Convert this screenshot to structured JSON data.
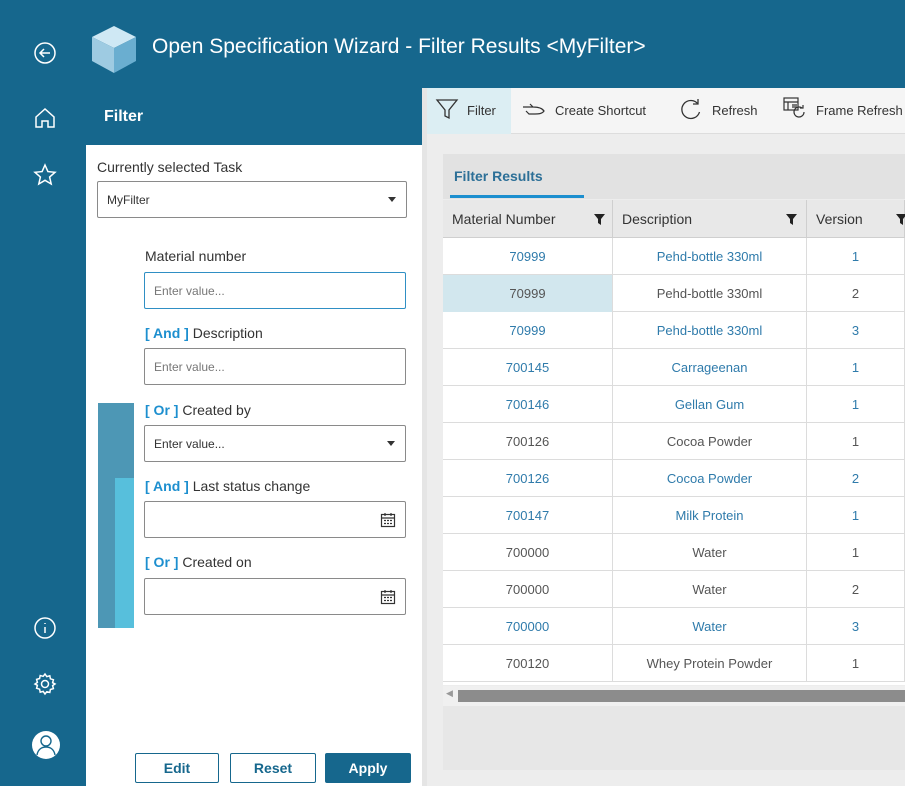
{
  "app": {
    "title": "Open Specification Wizard - Filter Results <MyFilter>",
    "accent": "#16678d",
    "highlight": "#1d8fcf"
  },
  "rail": {
    "items": [
      {
        "icon": "back-arrow-icon"
      },
      {
        "icon": "home-icon"
      },
      {
        "icon": "star-icon"
      },
      {
        "icon": "info-icon"
      },
      {
        "icon": "gear-icon"
      },
      {
        "icon": "user-avatar-icon"
      }
    ]
  },
  "filter": {
    "header": "Filter",
    "task_label": "Currently selected Task",
    "task_value": "MyFilter",
    "fields": [
      {
        "operator": "",
        "label": "Material number",
        "placeholder": "Enter value..."
      },
      {
        "operator": "[ And ]",
        "label": " Description",
        "placeholder": "Enter value..."
      },
      {
        "operator": "[ Or ]",
        "label": " Created by",
        "placeholder": "Enter value..."
      },
      {
        "operator": "[ And ]",
        "label": " Last status change",
        "placeholder": ""
      },
      {
        "operator": "[ Or ]",
        "label": " Created on",
        "placeholder": ""
      }
    ],
    "buttons": {
      "edit": "Edit",
      "reset": "Reset",
      "apply": "Apply"
    }
  },
  "toolbar": {
    "filter": "Filter",
    "create_shortcut": "Create Shortcut",
    "refresh": "Refresh",
    "frame_refresh": "Frame Refresh"
  },
  "results": {
    "tab": "Filter Results",
    "columns": [
      "Material Number",
      "Description",
      "Version"
    ],
    "rows": [
      {
        "material": "70999",
        "description": "Pehd-bottle 330ml",
        "version": "1"
      },
      {
        "material": "70999",
        "description": "Pehd-bottle 330ml",
        "version": "2"
      },
      {
        "material": "70999",
        "description": "Pehd-bottle 330ml",
        "version": "3"
      },
      {
        "material": "700145",
        "description": "Carrageenan",
        "version": "1"
      },
      {
        "material": "700146",
        "description": "Gellan Gum",
        "version": "1"
      },
      {
        "material": "700126",
        "description": "Cocoa Powder",
        "version": "1"
      },
      {
        "material": "700126",
        "description": "Cocoa Powder",
        "version": "2"
      },
      {
        "material": "700147",
        "description": "Milk Protein",
        "version": "1"
      },
      {
        "material": "700000",
        "description": "Water",
        "version": "1"
      },
      {
        "material": "700000",
        "description": "Water",
        "version": "2"
      },
      {
        "material": "700000",
        "description": "Water",
        "version": "3"
      },
      {
        "material": "700120",
        "description": "Whey Protein Powder",
        "version": "1"
      }
    ]
  }
}
